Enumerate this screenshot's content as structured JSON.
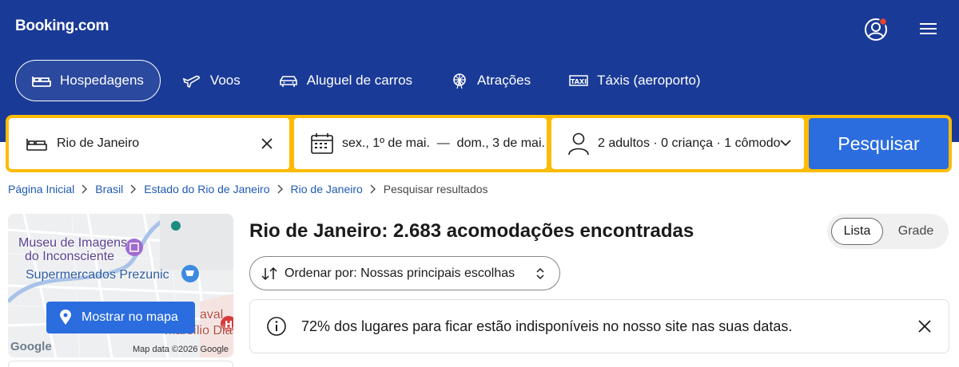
{
  "header": {
    "logo": "Booking.com",
    "account_icon": "account-circle-icon",
    "menu_icon": "hamburger-menu-icon",
    "notification_color": "#e8432d"
  },
  "nav": {
    "items": [
      {
        "label": "Hospedagens",
        "icon": "bed-icon",
        "active": true
      },
      {
        "label": "Voos",
        "icon": "plane-icon"
      },
      {
        "label": "Aluguel de carros",
        "icon": "car-icon"
      },
      {
        "label": "Atrações",
        "icon": "ferris-wheel-icon"
      },
      {
        "label": "Táxis (aeroporto)",
        "icon": "taxi-icon"
      }
    ]
  },
  "search": {
    "destination": "Rio de Janeiro",
    "dates": "sex., 1º de mai.  —  dom., 3 de mai.",
    "guests": "2 adultos · 0 criança · 1 cômodo",
    "button": "Pesquisar"
  },
  "breadcrumb": {
    "items": [
      "Página Inicial",
      "Brasil",
      "Estado do Rio de Janeiro",
      "Rio de Janeiro"
    ],
    "current": "Pesquisar resultados"
  },
  "map": {
    "labels": [
      "Museu de Imagens",
      "do Inconsciente",
      "Supermercados Prezunic",
      "aval",
      "Marcílio Dias"
    ],
    "button": "Mostrar no mapa",
    "google": "Google",
    "copyright": "Map data ©2026 Google"
  },
  "results": {
    "title": "Rio de Janeiro: 2.683 acomodações encontradas",
    "view_list": "Lista",
    "view_grid": "Grade",
    "sort": "Ordenar por: Nossas principais escolhas",
    "notice": "72% dos lugares para ficar estão indisponíveis no nosso site nas suas datas."
  },
  "colors": {
    "header_bg": "#193a96",
    "search_border": "#febb02",
    "primary_blue": "#2b6ddf",
    "link": "#1f5ab4"
  }
}
